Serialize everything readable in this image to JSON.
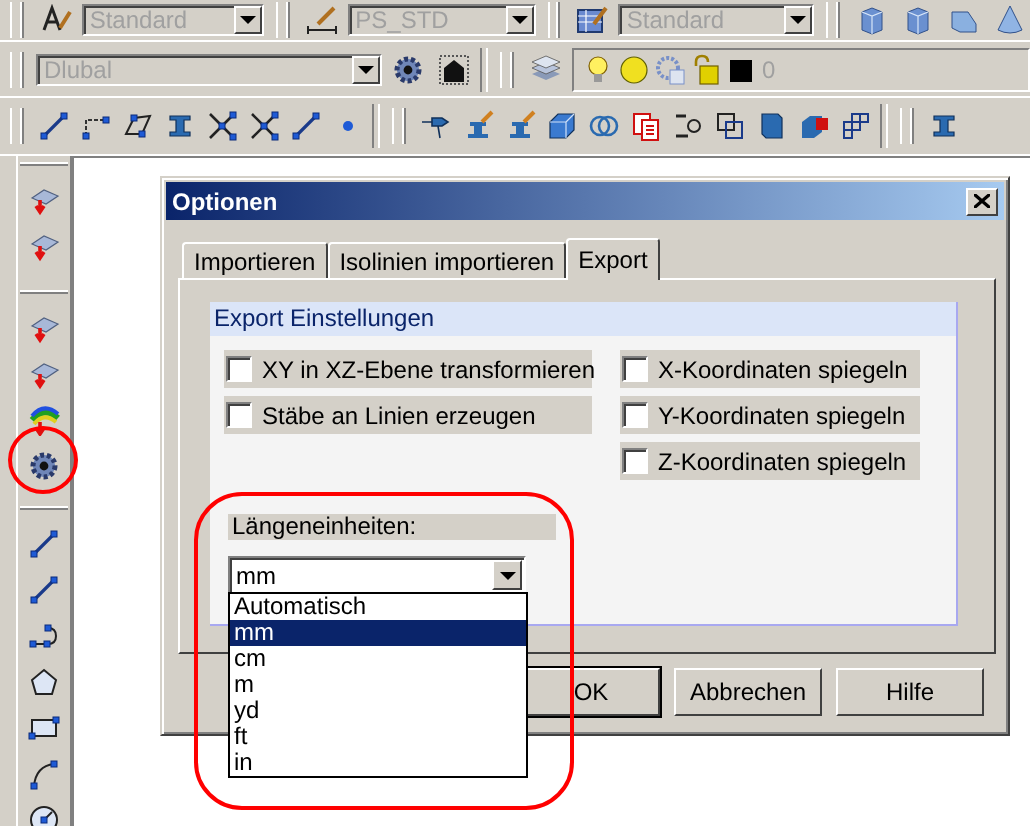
{
  "toolbar_combos": [
    {
      "value": "Standard",
      "disabled": true
    },
    {
      "value": "PS_STD",
      "disabled": true
    },
    {
      "value": "Standard",
      "disabled": true
    },
    {
      "value": "Dlubal",
      "disabled": true
    }
  ],
  "layer": {
    "name": "0",
    "disabled": true
  },
  "dialog": {
    "title": "Optionen",
    "tabs": [
      {
        "label": "Importieren",
        "selected": false
      },
      {
        "label": "Isolinien importieren",
        "selected": false
      },
      {
        "label": "Export",
        "selected": true
      }
    ],
    "group": {
      "title": "Export Einstellungen",
      "left_options": [
        {
          "label": "XY in XZ-Ebene transformieren",
          "checked": false
        },
        {
          "label": "Stäbe an Linien erzeugen",
          "checked": false
        }
      ],
      "right_options": [
        {
          "label": "X-Koordinaten spiegeln",
          "checked": false
        },
        {
          "label": "Y-Koordinaten spiegeln",
          "checked": false
        },
        {
          "label": "Z-Koordinaten spiegeln",
          "checked": false
        }
      ]
    },
    "units": {
      "label": "Längeneinheiten:",
      "value": "mm",
      "expanded": true,
      "options": [
        {
          "label": "Automatisch",
          "selected": false
        },
        {
          "label": "mm",
          "selected": true
        },
        {
          "label": "cm",
          "selected": false
        },
        {
          "label": "m",
          "selected": false
        },
        {
          "label": "yd",
          "selected": false
        },
        {
          "label": "ft",
          "selected": false
        },
        {
          "label": "in",
          "selected": false
        }
      ]
    },
    "buttons": [
      "OK",
      "Abbrechen",
      "Hilfe"
    ]
  }
}
